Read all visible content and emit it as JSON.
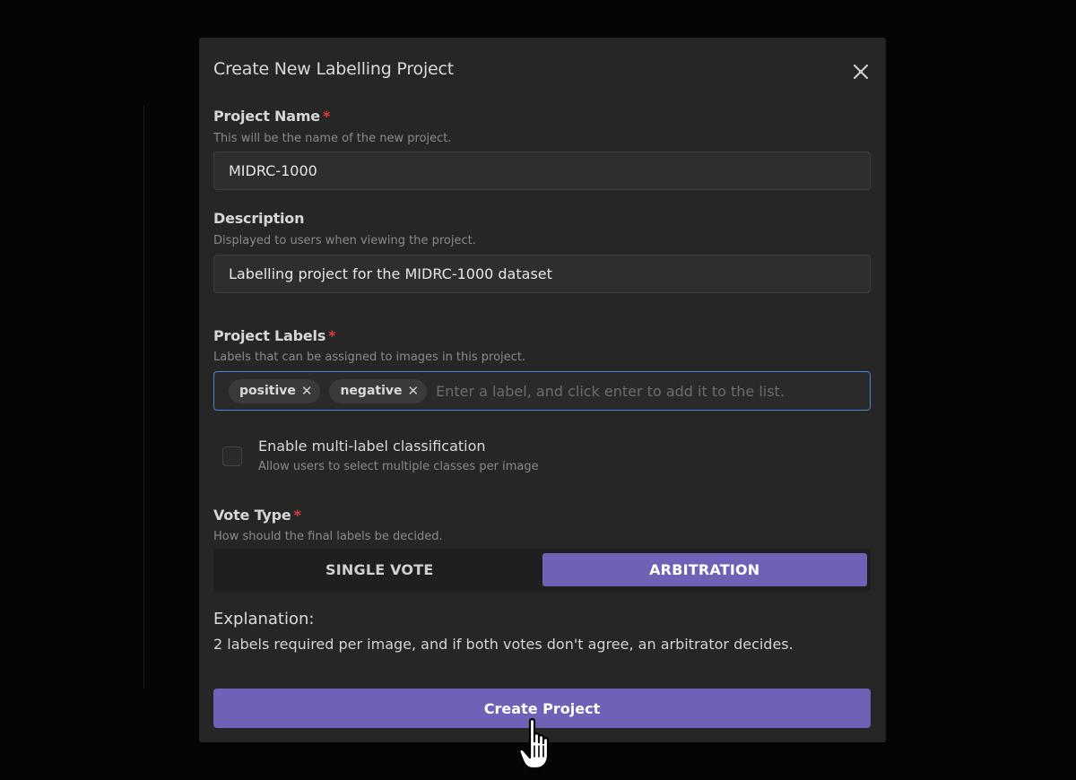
{
  "modal": {
    "title": "Create New Labelling Project"
  },
  "project_name": {
    "label": "Project Name",
    "required_mark": "*",
    "help": "This will be the name of the new project.",
    "value": "MIDRC-1000"
  },
  "description": {
    "label": "Description",
    "help": "Displayed to users when viewing the project.",
    "value": "Labelling project for the MIDRC-1000 dataset"
  },
  "project_labels": {
    "label": "Project Labels",
    "required_mark": "*",
    "help": "Labels that can be assigned to images in this project.",
    "tags": [
      "positive",
      "negative"
    ],
    "remove_glyph": "✕",
    "placeholder": "Enter a label, and click enter to add it to the list."
  },
  "multi_label": {
    "label": "Enable multi-label classification",
    "help": "Allow users to select multiple classes per image",
    "checked": false
  },
  "vote_type": {
    "label": "Vote Type",
    "required_mark": "*",
    "help": "How should the final labels be decided.",
    "options": [
      "SINGLE VOTE",
      "ARBITRATION"
    ],
    "selected": "ARBITRATION"
  },
  "explanation": {
    "title": "Explanation:",
    "text": "2 labels required per image, and if both votes don't agree, an arbitrator decides."
  },
  "actions": {
    "create_label": "Create Project"
  },
  "colors": {
    "accent": "#6f62b6",
    "required": "#e23b3b",
    "focus_border": "#4a82d4"
  }
}
